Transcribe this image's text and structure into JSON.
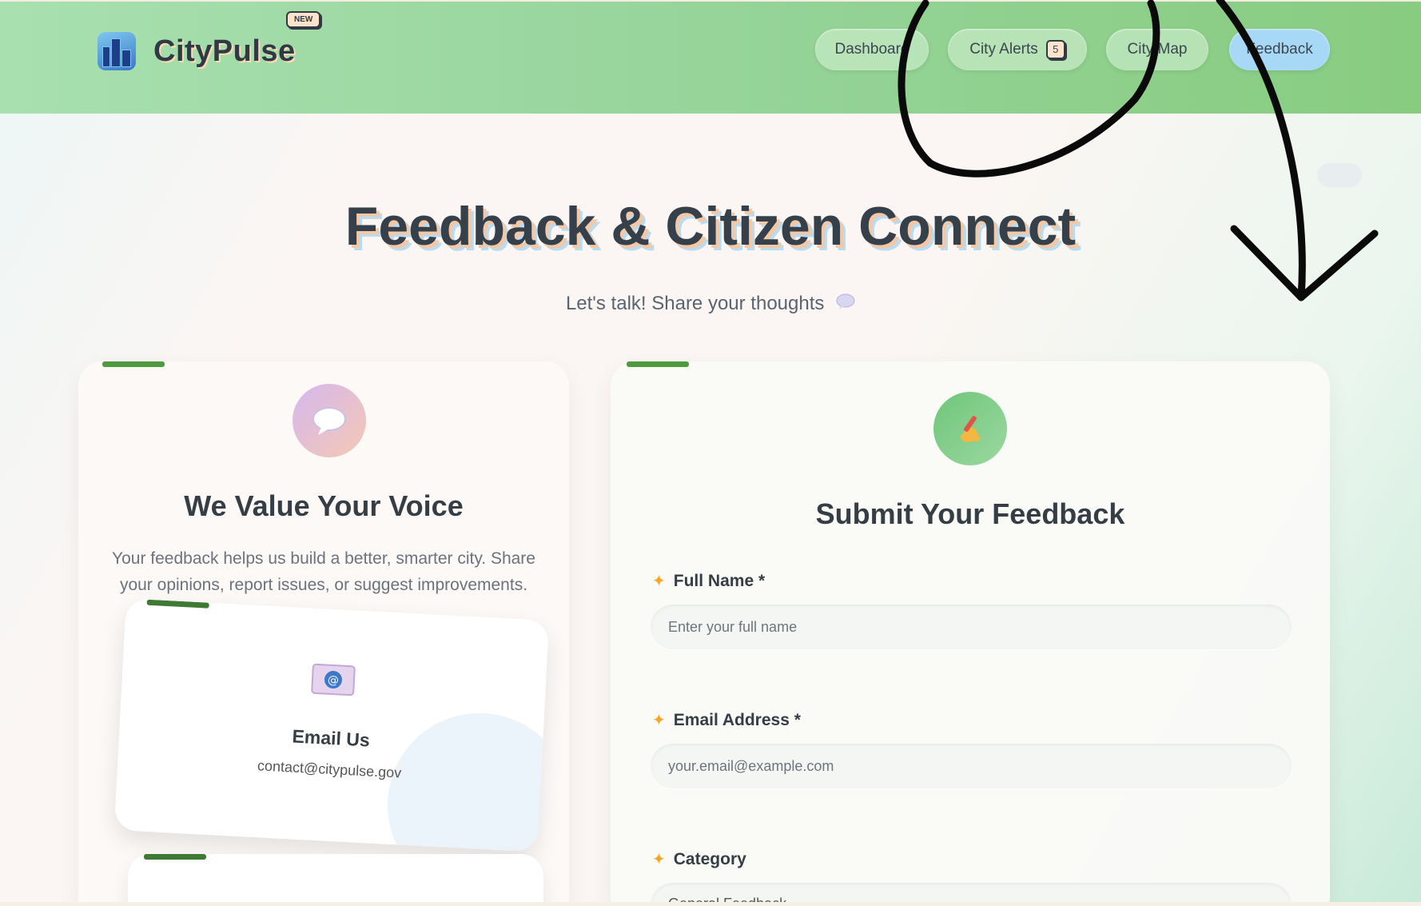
{
  "header": {
    "brand_name": "CityPulse",
    "new_badge": "NEW",
    "nav": [
      {
        "label": "Dashboard"
      },
      {
        "label": "City Alerts",
        "count": "5"
      },
      {
        "label": "City Map"
      },
      {
        "label": "Feedback",
        "active": true
      }
    ]
  },
  "page": {
    "title": "Feedback & Citizen Connect",
    "subtitle": "Let's talk! Share your thoughts"
  },
  "left_card": {
    "title": "We Value Your Voice",
    "description_line1": "Your feedback helps us build a better, smarter city. Share",
    "description_line2": "your opinions, report issues, or suggest improvements.",
    "contact": {
      "title": "Email Us",
      "value": "contact@citypulse.gov"
    }
  },
  "right_card": {
    "title": "Submit Your Feedback",
    "fields": [
      {
        "label": "Full Name *",
        "placeholder": "Enter your full name"
      },
      {
        "label": "Email Address *",
        "placeholder": "your.email@example.com"
      },
      {
        "label": "Category",
        "value": "General Feedback"
      }
    ]
  },
  "icons": {
    "brand": "city-buildings-icon",
    "speech": "speech-bubble-icon",
    "writing": "writing-hand-icon",
    "email": "email-icon",
    "sparkle": "sparkle-icon"
  },
  "colors": {
    "header_green": "#96d49a",
    "active_nav": "#a7d9f6",
    "accent_bar": "#4d9a3f",
    "title_text": "#36404a"
  }
}
